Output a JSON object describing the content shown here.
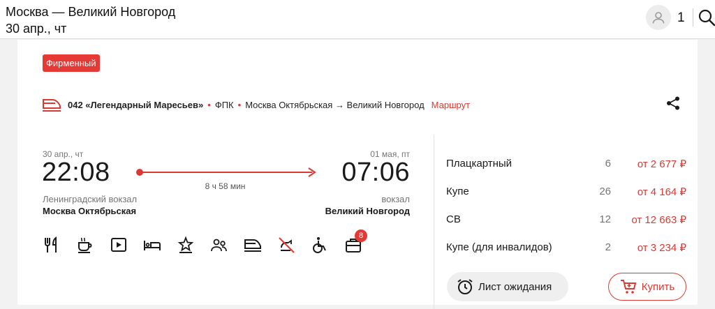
{
  "header": {
    "route": "Москва — Великий Новгород",
    "date": "30 апр., чт",
    "passengers": "1"
  },
  "badge": "Фирменный",
  "train": {
    "name": "042 «Легендарный Маресьев»",
    "carrier": "ФПК",
    "route": "Москва Октябрьская → Великий Новгород",
    "route_link": "Маршрут"
  },
  "departure": {
    "date": "30 апр., чт",
    "time": "22:08",
    "terminal": "Ленинградский вокзал",
    "station": "Москва Октябрьская"
  },
  "arrival": {
    "date": "01 мая, пт",
    "time": "07:06",
    "terminal": "вокзал",
    "station": "Великий Новгород"
  },
  "duration": "8 ч 58 мин",
  "amenities": {
    "items": [
      "restaurant-icon",
      "coffee-icon",
      "media-icon",
      "bed-icon",
      "premium-icon",
      "companions-icon",
      "train-icon",
      "no-pets-icon",
      "wheelchair-icon",
      "more-services-icon"
    ],
    "more_count": "8"
  },
  "fares": [
    {
      "class": "Плацкартный",
      "seats": "6",
      "price": "от 2 677 ₽"
    },
    {
      "class": "Купе",
      "seats": "26",
      "price": "от 4 164 ₽"
    },
    {
      "class": "СВ",
      "seats": "12",
      "price": "от 12 663 ₽"
    },
    {
      "class": "Купе (для инвалидов)",
      "seats": "2",
      "price": "от 3 234 ₽"
    }
  ],
  "buttons": {
    "waitlist": "Лист ожидания",
    "buy": "Купить"
  },
  "colors": {
    "accent": "#d93a33",
    "badge": "#e53935"
  }
}
